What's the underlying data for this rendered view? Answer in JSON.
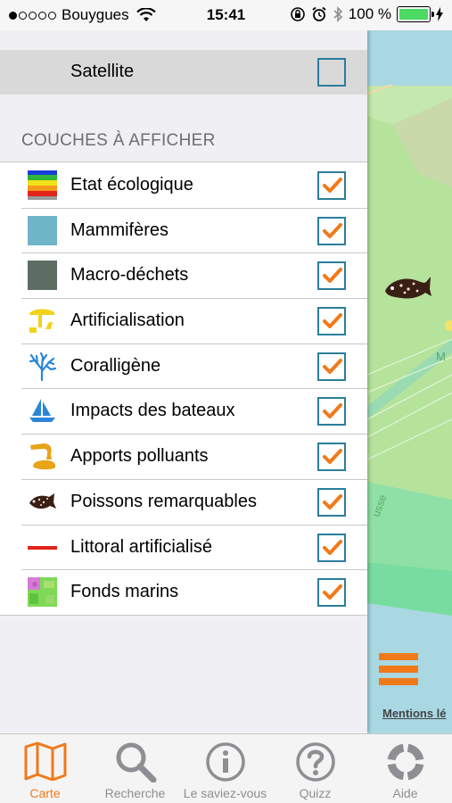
{
  "status_bar": {
    "carrier": "Bouygues",
    "time": "15:41",
    "battery": "100 %",
    "signal_dots_filled": 1,
    "signal_dots_total": 5
  },
  "panel": {
    "satellite": {
      "label": "Satellite",
      "checked": false
    },
    "section_title": "COUCHES À AFFICHER",
    "layers": [
      {
        "label": "Etat écologique",
        "icon": "ecological-status-icon",
        "checked": true
      },
      {
        "label": "Mammifères",
        "icon": "mammals-icon",
        "checked": true
      },
      {
        "label": "Macro-déchets",
        "icon": "macro-waste-icon",
        "checked": true
      },
      {
        "label": "Artificialisation",
        "icon": "artificialisation-icon",
        "checked": true
      },
      {
        "label": "Coralligène",
        "icon": "coral-icon",
        "checked": true
      },
      {
        "label": "Impacts des bateaux",
        "icon": "boat-icon",
        "checked": true
      },
      {
        "label": "Apports polluants",
        "icon": "pollutant-pipe-icon",
        "checked": true
      },
      {
        "label": "Poissons remarquables",
        "icon": "fish-icon",
        "checked": true
      },
      {
        "label": "Littoral artificialisé",
        "icon": "artificial-coastline-icon",
        "checked": true
      },
      {
        "label": "Fonds marins",
        "icon": "seabed-icon",
        "checked": true
      }
    ]
  },
  "map": {
    "attribution": "Mentions lé",
    "label_fragment_1": "M",
    "label_fragment_2": "usse"
  },
  "tabbar": {
    "tabs": [
      {
        "label": "Carte",
        "icon": "map-icon",
        "active": true
      },
      {
        "label": "Recherche",
        "icon": "search-icon",
        "active": false
      },
      {
        "label": "Le saviez-vous",
        "icon": "info-icon",
        "active": false
      },
      {
        "label": "Quizz",
        "icon": "question-icon",
        "active": false
      },
      {
        "label": "Aide",
        "icon": "lifebuoy-icon",
        "active": false
      }
    ]
  },
  "colors": {
    "accent": "#f07a1a",
    "checkbox_border": "#2b7d9b",
    "map_land_green": "#b5e39c",
    "map_sea_blue": "#a9d8e3"
  }
}
